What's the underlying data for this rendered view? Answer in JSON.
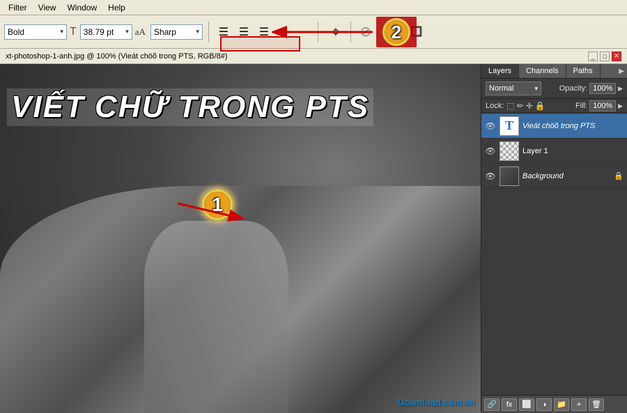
{
  "menu": {
    "items": [
      "Filter",
      "View",
      "Window",
      "Help"
    ]
  },
  "toolbar": {
    "font_style_label": "Bold",
    "font_style_arrow": "▾",
    "font_size_label": "38.79 pt",
    "font_size_arrow": "▾",
    "aa_label": "aA",
    "sharp_label": "Sharp",
    "sharp_arrow": "▾",
    "align_left": "≡",
    "align_center": "≡",
    "align_right": "≡",
    "cancel_icon": "⊘",
    "confirm_icon": "✓",
    "warp_icon": "⌖"
  },
  "title_bar": {
    "text": "xt-photoshop-1-anh.jpg @ 100% (Vieát chöõ trong PTS, RGB/8#)"
  },
  "canvas": {
    "text": "VIẾT CHỮ TRONG PTS"
  },
  "layers_panel": {
    "tabs": [
      "Layers",
      "Channels",
      "Paths"
    ],
    "blend_mode": "Normal",
    "opacity_label": "Opacity:",
    "opacity_value": "100%",
    "lock_label": "Lock:",
    "fill_label": "Fill:",
    "fill_value": "100%",
    "layers": [
      {
        "name": "Vieát chöõ trong PTS",
        "type": "text",
        "active": true,
        "visible": true
      },
      {
        "name": "Layer 1",
        "type": "transparent",
        "active": false,
        "visible": true
      },
      {
        "name": "Background",
        "type": "dark",
        "active": false,
        "visible": true,
        "locked": true
      }
    ]
  },
  "annotations": {
    "badge1": "1",
    "badge2": "2"
  },
  "watermark": "Download.com.vn"
}
